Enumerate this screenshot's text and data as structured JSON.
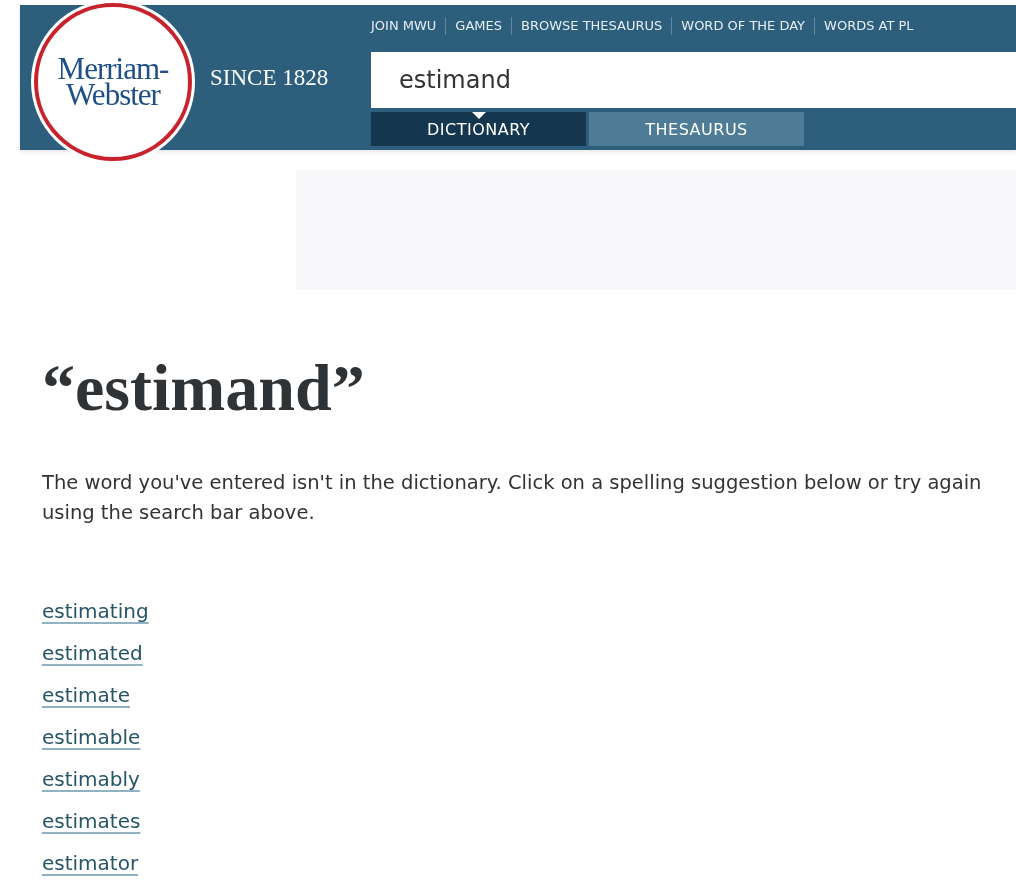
{
  "logo": {
    "text": "Merriam-Webster"
  },
  "tagline": "SINCE 1828",
  "nav": [
    "JOIN MWU",
    "GAMES",
    "BROWSE THESAURUS",
    "WORD OF THE DAY",
    "WORDS AT PL"
  ],
  "search": {
    "value": "estimand"
  },
  "tabs": [
    {
      "label": "DICTIONARY",
      "selected": true
    },
    {
      "label": "THESAURUS",
      "selected": false
    }
  ],
  "headword": "“estimand”",
  "message": "The word you've entered isn't in the dictionary. Click on a spelling suggestion below or try again using the search bar above.",
  "suggestions": [
    "estimating",
    "estimated",
    "estimate",
    "estimable",
    "estimably",
    "estimates",
    "estimator"
  ]
}
